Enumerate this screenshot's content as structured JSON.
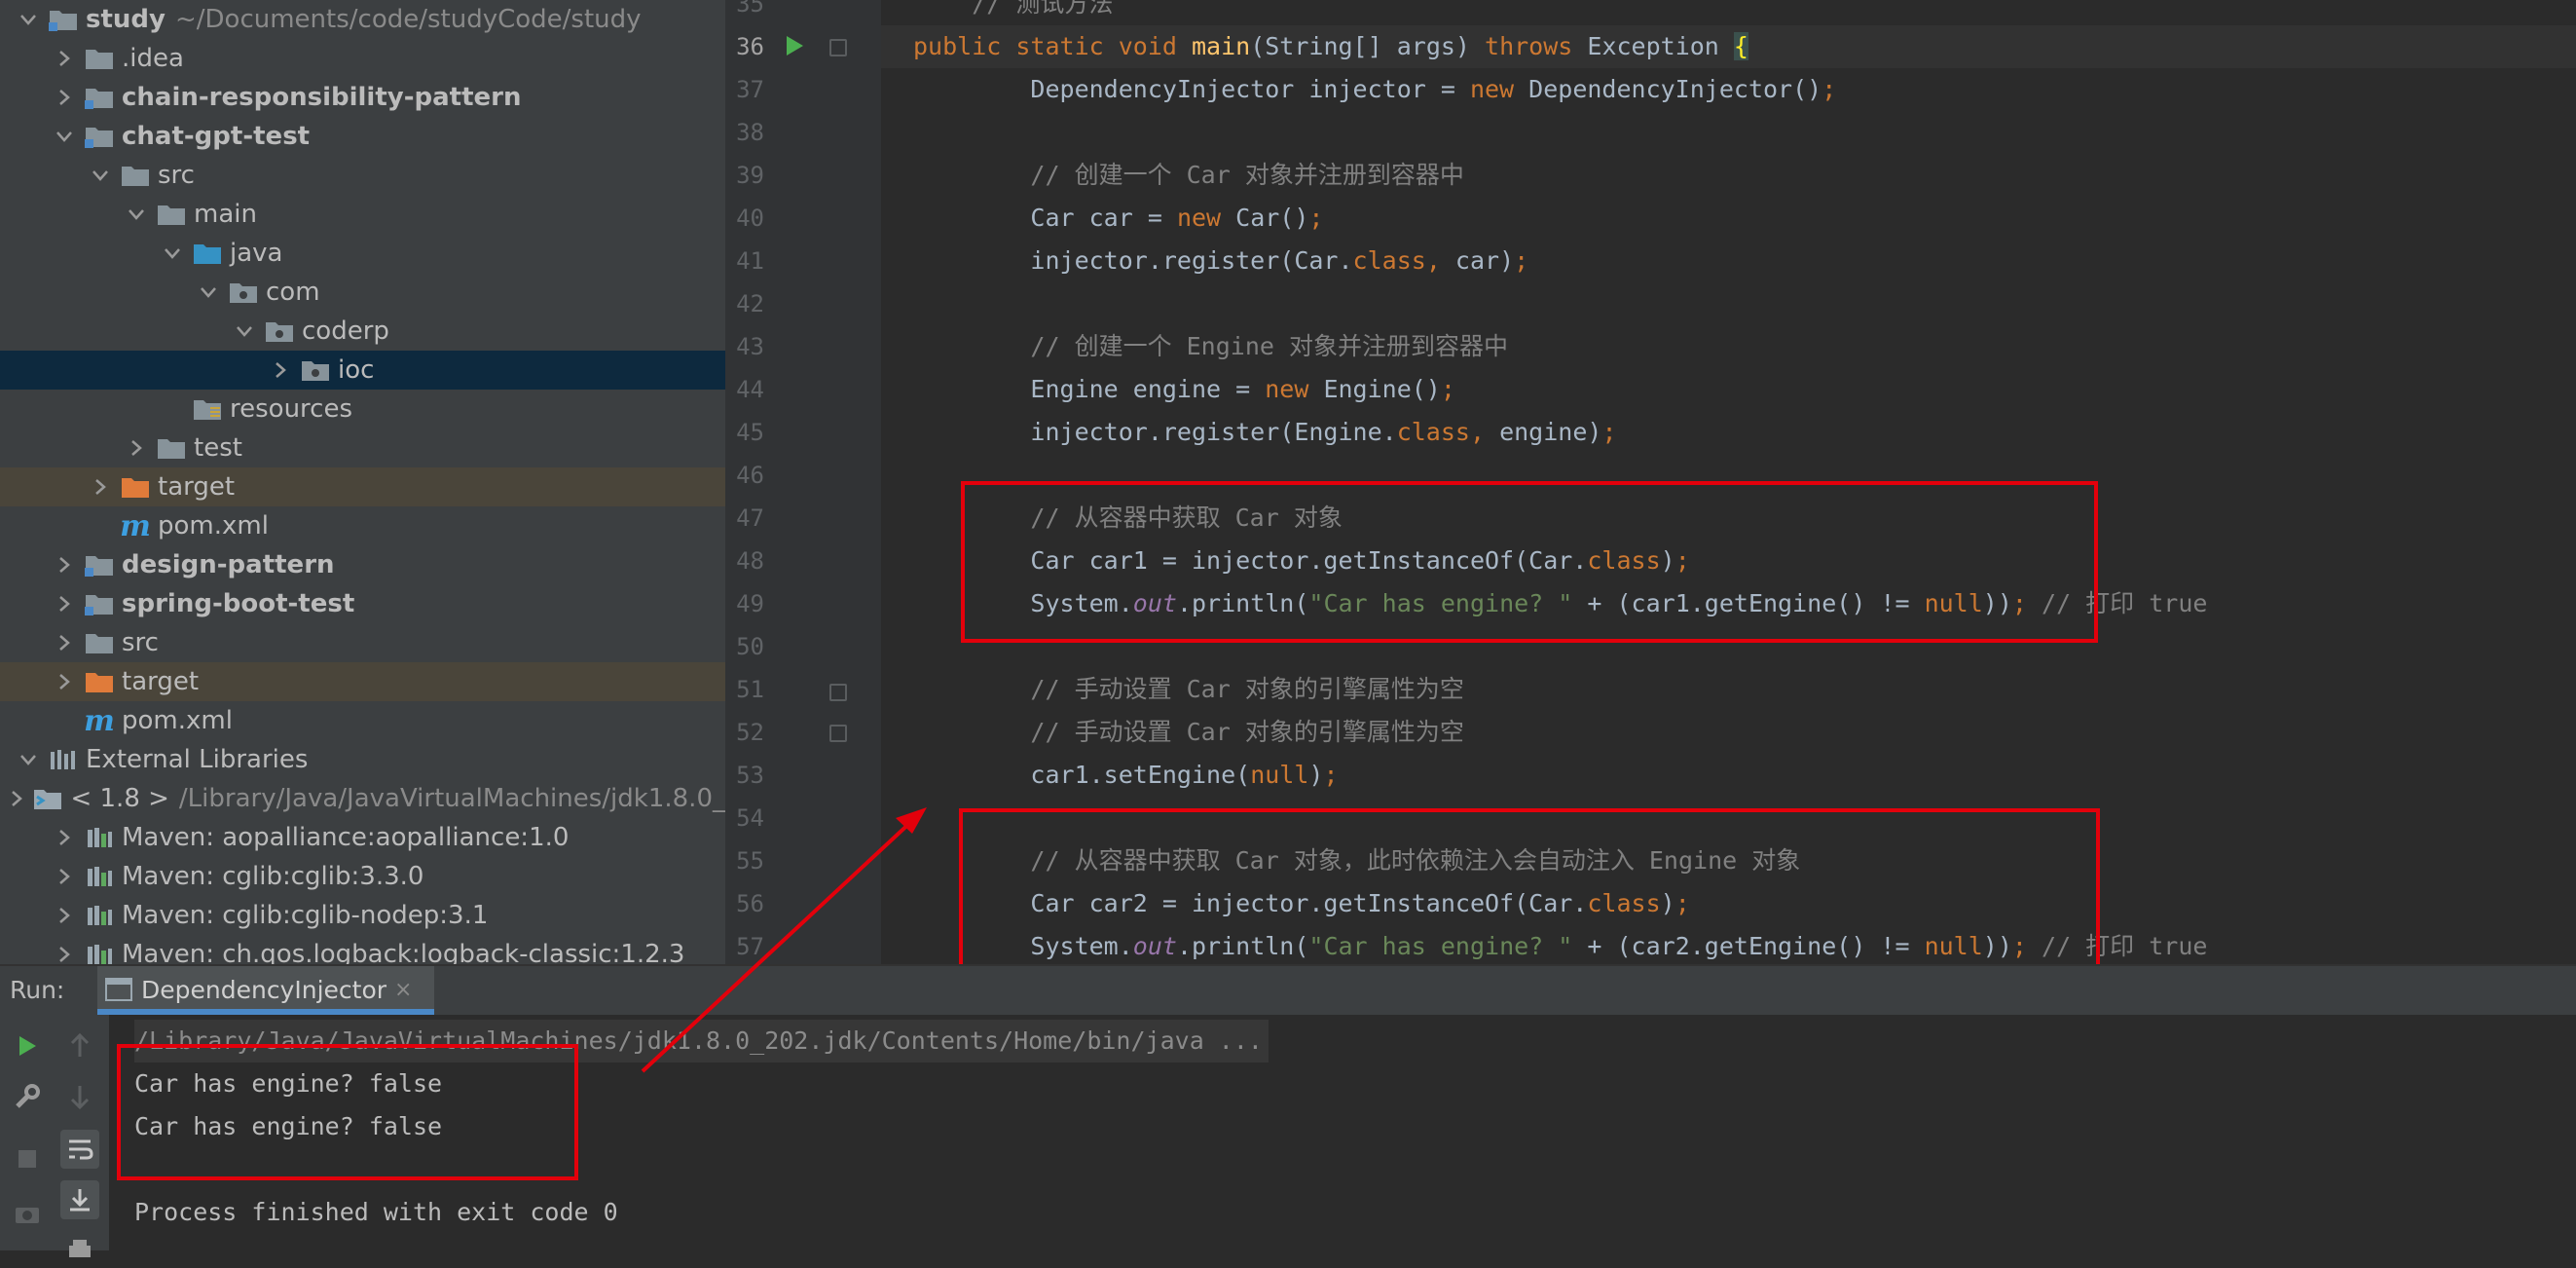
{
  "project_tree": {
    "items": [
      {
        "label": "study",
        "path": "~/Documents/code/studyCode/study",
        "bold": true,
        "depth": 0,
        "expanded": true,
        "icon": "module-folder-icon"
      },
      {
        "label": ".idea",
        "depth": 1,
        "expanded": false,
        "icon": "folder-icon"
      },
      {
        "label": "chain-responsibility-pattern",
        "bold": true,
        "depth": 1,
        "expanded": false,
        "icon": "module-folder-icon"
      },
      {
        "label": "chat-gpt-test",
        "bold": true,
        "depth": 1,
        "expanded": true,
        "icon": "module-folder-icon"
      },
      {
        "label": "src",
        "depth": 2,
        "expanded": true,
        "icon": "folder-icon"
      },
      {
        "label": "main",
        "depth": 3,
        "expanded": true,
        "icon": "folder-icon"
      },
      {
        "label": "java",
        "depth": 4,
        "expanded": true,
        "icon": "source-folder-icon"
      },
      {
        "label": "com",
        "depth": 5,
        "expanded": true,
        "icon": "package-icon"
      },
      {
        "label": "coderp",
        "depth": 6,
        "expanded": true,
        "icon": "package-icon"
      },
      {
        "label": "ioc",
        "depth": 7,
        "expanded": false,
        "icon": "package-icon",
        "selected": true
      },
      {
        "label": "resources",
        "depth": 4,
        "icon": "resources-folder-icon"
      },
      {
        "label": "test",
        "depth": 3,
        "expanded": false,
        "icon": "folder-icon"
      },
      {
        "label": "target",
        "depth": 2,
        "expanded": false,
        "icon": "excluded-folder-icon",
        "excluded": true
      },
      {
        "label": "pom.xml",
        "depth": 2,
        "icon": "maven-file-icon"
      },
      {
        "label": "design-pattern",
        "bold": true,
        "depth": 1,
        "expanded": false,
        "icon": "module-folder-icon"
      },
      {
        "label": "spring-boot-test",
        "bold": true,
        "depth": 1,
        "expanded": false,
        "icon": "module-folder-icon"
      },
      {
        "label": "src",
        "depth": 1,
        "expanded": false,
        "icon": "folder-icon"
      },
      {
        "label": "target",
        "depth": 1,
        "expanded": false,
        "icon": "excluded-folder-icon",
        "excluded": true
      },
      {
        "label": "pom.xml",
        "depth": 1,
        "icon": "maven-file-icon"
      },
      {
        "label": "External Libraries",
        "depth": 0,
        "expanded": true,
        "icon": "libraries-icon"
      },
      {
        "label": "< 1.8 >",
        "path": "/Library/Java/JavaVirtualMachines/jdk1.8.0_",
        "depth": 1,
        "expanded": false,
        "icon": "jdk-icon"
      },
      {
        "label": "Maven: aopalliance:aopalliance:1.0",
        "depth": 1,
        "expanded": false,
        "icon": "library-icon"
      },
      {
        "label": "Maven: cglib:cglib:3.3.0",
        "depth": 1,
        "expanded": false,
        "icon": "library-icon"
      },
      {
        "label": "Maven: cglib:cglib-nodep:3.1",
        "depth": 1,
        "expanded": false,
        "icon": "library-icon"
      },
      {
        "label": "Maven: ch.qos.logback:logback-classic:1.2.3",
        "depth": 1,
        "expanded": false,
        "icon": "library-icon"
      }
    ]
  },
  "editor": {
    "current_line": 36,
    "lines": [
      {
        "num": 35,
        "tokens": [
          [
            "cm",
            "    // 测试方法"
          ]
        ]
      },
      {
        "num": 36,
        "tokens": [
          [
            "kw",
            "public static void "
          ],
          [
            "fn",
            "main"
          ],
          [
            "",
            "(String[] args) "
          ],
          [
            "kw",
            "throws "
          ],
          [
            "",
            "Exception "
          ],
          [
            "brace",
            "{"
          ]
        ]
      },
      {
        "num": 37,
        "tokens": [
          [
            "",
            "        DependencyInjector injector = "
          ],
          [
            "kw",
            "new "
          ],
          [
            "",
            "DependencyInjector()"
          ],
          [
            "kw",
            ";"
          ]
        ]
      },
      {
        "num": 38,
        "tokens": []
      },
      {
        "num": 39,
        "tokens": [
          [
            "cm",
            "        // 创建一个 Car 对象并注册到容器中"
          ]
        ]
      },
      {
        "num": 40,
        "tokens": [
          [
            "",
            "        Car car = "
          ],
          [
            "kw",
            "new "
          ],
          [
            "",
            "Car()"
          ],
          [
            "kw",
            ";"
          ]
        ]
      },
      {
        "num": 41,
        "tokens": [
          [
            "",
            "        injector.register(Car."
          ],
          [
            "kw",
            "class"
          ],
          [
            "kw",
            ", "
          ],
          [
            "",
            "car)"
          ],
          [
            "kw",
            ";"
          ]
        ]
      },
      {
        "num": 42,
        "tokens": []
      },
      {
        "num": 43,
        "tokens": [
          [
            "cm",
            "        // 创建一个 Engine 对象并注册到容器中"
          ]
        ]
      },
      {
        "num": 44,
        "tokens": [
          [
            "",
            "        Engine engine = "
          ],
          [
            "kw",
            "new "
          ],
          [
            "",
            "Engine()"
          ],
          [
            "kw",
            ";"
          ]
        ]
      },
      {
        "num": 45,
        "tokens": [
          [
            "",
            "        injector.register(Engine."
          ],
          [
            "kw",
            "class"
          ],
          [
            "kw",
            ", "
          ],
          [
            "",
            "engine)"
          ],
          [
            "kw",
            ";"
          ]
        ]
      },
      {
        "num": 46,
        "tokens": []
      },
      {
        "num": 47,
        "tokens": [
          [
            "cm",
            "        // 从容器中获取 Car 对象"
          ]
        ]
      },
      {
        "num": 48,
        "tokens": [
          [
            "",
            "        Car car1 = injector.getInstanceOf(Car."
          ],
          [
            "kw",
            "class"
          ],
          [
            "",
            ")"
          ],
          [
            "kw",
            ";"
          ]
        ]
      },
      {
        "num": 49,
        "tokens": [
          [
            "",
            "        System."
          ],
          [
            "sf",
            "out"
          ],
          [
            "",
            ".println("
          ],
          [
            "st",
            "\"Car has engine? \""
          ],
          [
            "",
            " + (car1.getEngine() != "
          ],
          [
            "kw",
            "null"
          ],
          [
            "",
            "))"
          ],
          [
            "kw",
            "; "
          ],
          [
            "cm",
            "// 打印 true"
          ]
        ]
      },
      {
        "num": 50,
        "tokens": []
      },
      {
        "num": 51,
        "tokens": [
          [
            "cm",
            "        // 手动设置 Car 对象的引擎属性为空"
          ]
        ]
      },
      {
        "num": 52,
        "tokens": [
          [
            "cm",
            "        // 手动设置 Car 对象的引擎属性为空"
          ]
        ]
      },
      {
        "num": 53,
        "tokens": [
          [
            "",
            "        car1.setEngine("
          ],
          [
            "kw",
            "null"
          ],
          [
            "",
            ")"
          ],
          [
            "kw",
            ";"
          ]
        ]
      },
      {
        "num": 54,
        "tokens": []
      },
      {
        "num": 55,
        "tokens": [
          [
            "cm",
            "        // 从容器中获取 Car 对象，此时依赖注入会自动注入 Engine 对象"
          ]
        ]
      },
      {
        "num": 56,
        "tokens": [
          [
            "",
            "        Car car2 = injector.getInstanceOf(Car."
          ],
          [
            "kw",
            "class"
          ],
          [
            "",
            ")"
          ],
          [
            "kw",
            ";"
          ]
        ]
      },
      {
        "num": 57,
        "tokens": [
          [
            "",
            "        System."
          ],
          [
            "sf",
            "out"
          ],
          [
            "",
            ".println("
          ],
          [
            "st",
            "\"Car has engine? \""
          ],
          [
            "",
            " + (car2.getEngine() != "
          ],
          [
            "kw",
            "null"
          ],
          [
            "",
            "))"
          ],
          [
            "kw",
            "; "
          ],
          [
            "cm",
            "// 打印 true"
          ]
        ]
      }
    ]
  },
  "run_panel": {
    "label": "Run:",
    "tab_name": "DependencyInjector",
    "close_glyph": "×",
    "console": {
      "command": "/Library/Java/JavaVirtualMachines/jdk1.8.0_202.jdk/Contents/Home/bin/java ...",
      "output": [
        "Car has engine? false",
        "Car has engine? false"
      ],
      "exit_message": "Process finished with exit code 0"
    }
  },
  "colors": {
    "annotation_red": "#e3000b",
    "selection": "#0d293e",
    "tab_underline": "#4a88c7",
    "run_green": "#4caf50"
  }
}
